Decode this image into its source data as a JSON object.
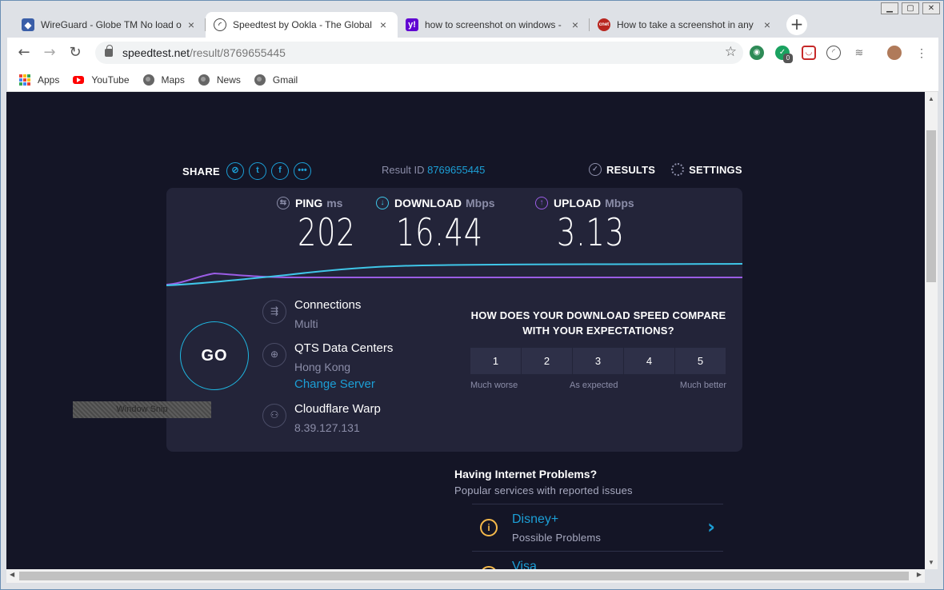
{
  "browser": {
    "tabs": [
      {
        "title": "WireGuard - Globe TM No load o",
        "icon": "wireguard-icon",
        "active": false
      },
      {
        "title": "Speedtest by Ookla - The Global",
        "icon": "speedometer-icon",
        "active": true
      },
      {
        "title": "how to screenshot on windows -",
        "icon": "yahoo-icon",
        "active": false
      },
      {
        "title": "How to take a screenshot in any",
        "icon": "cnet-icon",
        "active": false
      }
    ],
    "new_tab": "+",
    "url_host": "speedtest.net",
    "url_path": "/result/8769655445",
    "extension_badge": "0",
    "bookmarks": [
      {
        "label": "Apps",
        "icon": "apps-grid-icon"
      },
      {
        "label": "YouTube",
        "icon": "youtube-icon"
      },
      {
        "label": "Maps",
        "icon": "globe-icon"
      },
      {
        "label": "News",
        "icon": "globe-icon"
      },
      {
        "label": "Gmail",
        "icon": "globe-icon"
      }
    ]
  },
  "page": {
    "share_label": "SHARE",
    "result_id_label": "Result ID",
    "result_id": "8769655445",
    "results_label": "RESULTS",
    "settings_label": "SETTINGS",
    "ping": {
      "label": "PING",
      "unit": "ms",
      "value": "202"
    },
    "download": {
      "label": "DOWNLOAD",
      "unit": "Mbps",
      "value": "16.44"
    },
    "upload": {
      "label": "UPLOAD",
      "unit": "Mbps",
      "value": "3.13"
    },
    "go_label": "GO",
    "connections": {
      "label": "Connections",
      "value": "Multi"
    },
    "server": {
      "label": "QTS Data Centers",
      "location": "Hong Kong",
      "change": "Change Server"
    },
    "provider": {
      "label": "Cloudflare Warp",
      "ip": "8.39.127.131"
    },
    "compare_question": "HOW DOES YOUR DOWNLOAD SPEED COMPARE WITH YOUR EXPECTATIONS?",
    "ratings": [
      "1",
      "2",
      "3",
      "4",
      "5"
    ],
    "rating_labels": {
      "low": "Much worse",
      "mid": "As expected",
      "high": "Much better"
    },
    "snip_overlay": "Window Snip",
    "problems_title": "Having Internet Problems?",
    "problems_subtitle": "Popular services with reported issues",
    "services": [
      {
        "name": "Disney+",
        "status": "Possible Problems"
      },
      {
        "name": "Visa",
        "status": ""
      }
    ],
    "colors": {
      "background": "#141526",
      "panel": "#232439",
      "accent": "#1c9fd6",
      "download_line": "#3fc6e8",
      "upload_line": "#9b5de5",
      "warning": "#f5b94a"
    }
  }
}
